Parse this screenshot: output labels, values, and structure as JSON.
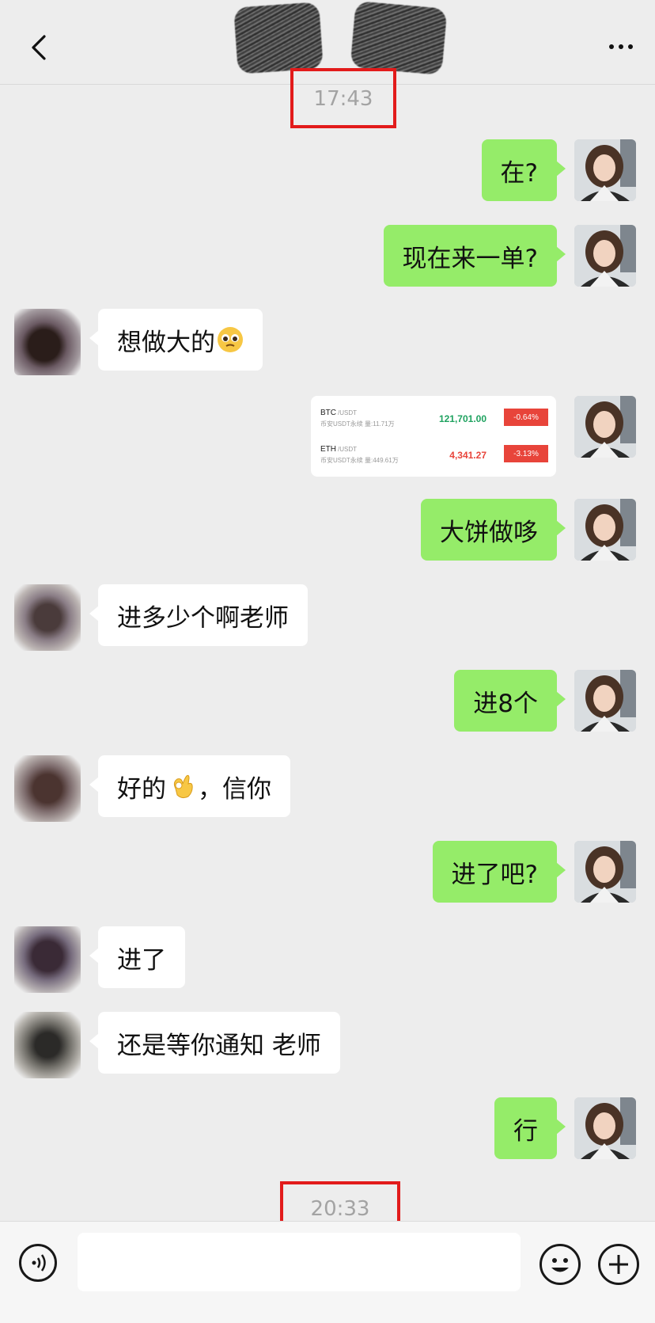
{
  "header": {
    "back_icon": "chevron-left-icon",
    "more_icon": "more-dots-icon"
  },
  "timestamps": {
    "first": "17:43",
    "second": "20:33"
  },
  "messages": [
    {
      "side": "me",
      "text": "在?"
    },
    {
      "side": "me",
      "text": "现在来一单?"
    },
    {
      "side": "other",
      "text": "想做大的",
      "emoji": "pleading-face-emoji"
    },
    {
      "side": "me",
      "type": "market-card"
    },
    {
      "side": "me",
      "text": "大饼做哆"
    },
    {
      "side": "other",
      "text": "进多少个啊老师"
    },
    {
      "side": "me",
      "text": "进8个"
    },
    {
      "side": "other",
      "text_before": "好的",
      "emoji": "ok-hand-emoji",
      "text_after": "，信你"
    },
    {
      "side": "me",
      "text": "进了吧?"
    },
    {
      "side": "other",
      "text": "进了"
    },
    {
      "side": "other",
      "text": "还是等你通知 老师"
    },
    {
      "side": "me",
      "text": "行"
    }
  ],
  "market_card": {
    "rows": [
      {
        "symbol": "BTC",
        "pair": "/USDT",
        "sub": "币安USDT永续 量:11.71万",
        "price": "121,701.00",
        "change": "-0.64%",
        "price_color": "#1ea25f"
      },
      {
        "symbol": "ETH",
        "pair": "/USDT",
        "sub": "币安USDT永续 量:449.61万",
        "price": "4,341.27",
        "change": "-3.13%",
        "price_color": "#e8443a"
      }
    ]
  },
  "input_bar": {
    "voice_icon": "voice-icon",
    "emoji_icon": "emoji-icon",
    "plus_icon": "plus-icon"
  },
  "colors": {
    "my_bubble": "#95ec69",
    "other_bubble": "#ffffff",
    "background": "#ededed",
    "highlight_box": "#e21b1b"
  }
}
